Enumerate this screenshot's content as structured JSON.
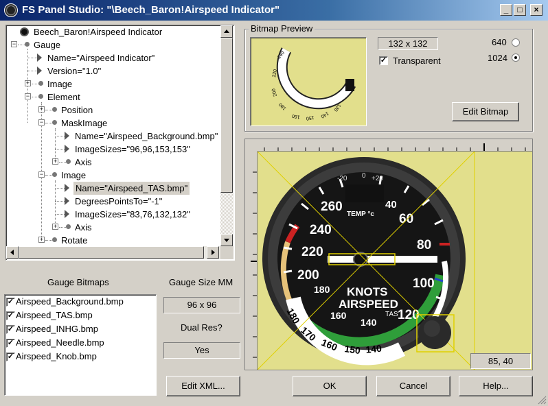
{
  "window": {
    "title": "FS Panel Studio: \"\\Beech_Baron!Airspeed Indicator\"",
    "minimize_glyph": "_",
    "maximize_glyph": "□",
    "close_glyph": "×"
  },
  "tree": {
    "items": [
      {
        "label": "Beech_Baron!Airspeed Indicator"
      },
      {
        "label": "Gauge"
      },
      {
        "label": "Name=\"Airspeed Indicator\""
      },
      {
        "label": "Version=\"1.0\""
      },
      {
        "label": "Image"
      },
      {
        "label": "Element"
      },
      {
        "label": "Position"
      },
      {
        "label": "MaskImage"
      },
      {
        "label": "Name=\"Airspeed_Background.bmp\""
      },
      {
        "label": "ImageSizes=\"96,96,153,153\""
      },
      {
        "label": "Axis"
      },
      {
        "label": "Image"
      },
      {
        "label": "Name=\"Airspeed_TAS.bmp\""
      },
      {
        "label": "DegreesPointsTo=\"-1\""
      },
      {
        "label": "ImageSizes=\"83,76,132,132\""
      },
      {
        "label": "Axis"
      },
      {
        "label": "Rotate"
      }
    ]
  },
  "bitmap_preview": {
    "group_label": "Bitmap Preview",
    "size": "132 x 132",
    "transparent_label": "Transparent",
    "transparent_checked": true,
    "res_640": "640",
    "res_1024": "1024",
    "selected_res": "1024",
    "edit_bitmap_label": "Edit Bitmap"
  },
  "gauge_bitmaps": {
    "label": "Gauge Bitmaps",
    "items": [
      {
        "name": "Airspeed_Background.bmp",
        "checked": true
      },
      {
        "name": "Airspeed_TAS.bmp",
        "checked": true
      },
      {
        "name": "Airspeed_INHG.bmp",
        "checked": true
      },
      {
        "name": "Airspeed_Needle.bmp",
        "checked": true
      },
      {
        "name": "Airspeed_Knob.bmp",
        "checked": true
      }
    ]
  },
  "gauge_size": {
    "label": "Gauge Size MM",
    "value": "96 x 96",
    "dual_res_label": "Dual Res?",
    "dual_res_value": "Yes"
  },
  "gauge_face": {
    "numbers": [
      "260",
      "240",
      "220",
      "200",
      "180",
      "160",
      "140",
      "120",
      "100",
      "80",
      "60",
      "40"
    ],
    "knots_label": "KNOTS",
    "airspeed_label": "AIRSPEED",
    "temp_label": "TEMP °c",
    "tas_label": "TAS",
    "temp_scale_minus": "-20",
    "temp_scale_zero": "0",
    "temp_scale_plus": "+20",
    "tas_ring_labels": [
      "180",
      "170",
      "160",
      "150",
      "140"
    ]
  },
  "preview_arc_labels": [
    "240",
    "220",
    "200",
    "180",
    "160",
    "150",
    "140",
    "130"
  ],
  "coords": "85, 40",
  "buttons": {
    "edit_xml": "Edit XML...",
    "ok": "OK",
    "cancel": "Cancel",
    "help": "Help..."
  },
  "colors": {
    "titlebar_start": "#0a246a",
    "preview_bg": "#e2df8c",
    "arc_green": "#2f9e3a",
    "arc_red": "#cc2222",
    "arc_white": "#ffffff",
    "arc_blue": "#2244cc"
  }
}
